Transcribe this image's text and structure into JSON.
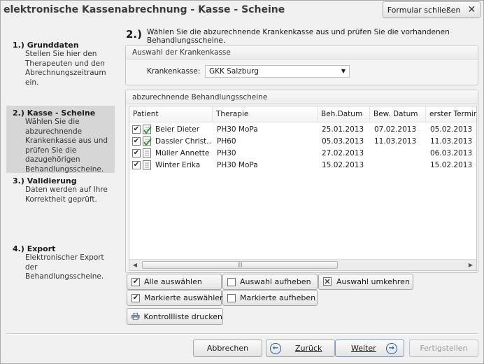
{
  "window": {
    "title": "elektronische Kassenabrechnung - Kasse - Scheine"
  },
  "close_button": {
    "label": "Formular schließen",
    "icon": "close-icon"
  },
  "sidebar": {
    "steps": [
      {
        "title": "1.) Grunddaten",
        "desc": "Stellen Sie hier den Therapeuten und den Abrechnungszeitraum ein."
      },
      {
        "title": "2.) Kasse - Scheine",
        "desc": "Wählen Sie die abzurechnende Krankenkasse aus und prüfen Sie die dazugehörigen Behandlungsscheine.",
        "active": true
      },
      {
        "title": "3.) Validierung",
        "desc": "Daten werden auf Ihre Korrektheit geprüft."
      },
      {
        "title": "4.) Export",
        "desc": "Elektronischer Export der Behandlungsscheine."
      }
    ]
  },
  "main": {
    "step_number": "2.)",
    "instruction": "Wählen Sie die abzurechnende Krankenkasse aus und prüfen Sie die vorhandenen Behandlungsscheine."
  },
  "kasse_group": {
    "title": "Auswahl der Krankenkasse",
    "label": "Krankenkasse:",
    "selected": "GKK Salzburg"
  },
  "scheine_group": {
    "title": "abzurechnende Behandlungsscheine",
    "columns": [
      "Patient",
      "Therapie",
      "Beh.Datum",
      "Bew. Datum",
      "erster Termin"
    ],
    "rows": [
      {
        "checked": true,
        "approved": true,
        "patient": "Beier Dieter",
        "therapie": "PH30 MoPa",
        "beh_datum": "25.01.2013",
        "bew_datum": "07.02.2013",
        "erster_termin": "05.02.2013"
      },
      {
        "checked": true,
        "approved": true,
        "patient": "Dassler Christ...",
        "therapie": "PH60",
        "beh_datum": "05.03.2013",
        "bew_datum": "11.03.2013",
        "erster_termin": "11.03.2013"
      },
      {
        "checked": true,
        "approved": false,
        "patient": "Müller Annette",
        "therapie": "PH30",
        "beh_datum": "27.02.2013",
        "bew_datum": "",
        "erster_termin": "06.03.2013"
      },
      {
        "checked": true,
        "approved": false,
        "patient": "Winter Erika",
        "therapie": "PH30 MoPa",
        "beh_datum": "15.02.2013",
        "bew_datum": "",
        "erster_termin": "15.02.2013"
      }
    ]
  },
  "actions": {
    "select_all": {
      "label": "Alle auswählen",
      "checked": true
    },
    "deselect": {
      "label": "Auswahl aufheben",
      "checked": false
    },
    "invert": {
      "label": "Auswahl umkehren"
    },
    "select_marked": {
      "label": "Markierte auswählen",
      "checked": true
    },
    "unmark": {
      "label": "Markierte aufheben",
      "checked": false
    },
    "print": {
      "label": "Kontrollliste drucken",
      "icon": "printer-icon"
    }
  },
  "footer": {
    "cancel": "Abbrechen",
    "back": "Zurück",
    "next": "Weiter",
    "finish": "Fertigstellen"
  },
  "colors": {
    "accent": "#1d5aa6",
    "check_green": "#2f9a2f",
    "active_step_bg": "#d6d6d6"
  }
}
